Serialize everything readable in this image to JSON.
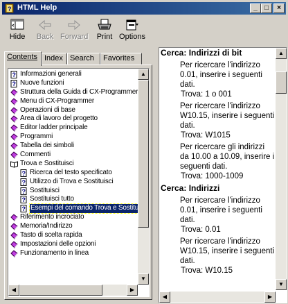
{
  "window": {
    "title": "HTML Help",
    "buttons": {
      "minimize": "_",
      "maximize": "□",
      "close": "×"
    }
  },
  "toolbar": {
    "items": [
      {
        "label": "Hide",
        "icon": "hide-icon",
        "enabled": true
      },
      {
        "label": "Back",
        "icon": "back-arrow-icon",
        "enabled": false
      },
      {
        "label": "Forward",
        "icon": "forward-arrow-icon",
        "enabled": false
      },
      {
        "label": "Print",
        "icon": "printer-icon",
        "enabled": true
      },
      {
        "label": "Options",
        "icon": "options-icon",
        "enabled": true
      }
    ]
  },
  "tabs": [
    {
      "label": "Contents",
      "active": true
    },
    {
      "label": "Index",
      "active": false
    },
    {
      "label": "Search",
      "active": false
    },
    {
      "label": "Favorites",
      "active": false
    }
  ],
  "tree": [
    {
      "label": "Informazioni generali",
      "icon": "page-question-icon",
      "indent": 0
    },
    {
      "label": "Nuove funzioni",
      "icon": "page-question-icon",
      "indent": 0
    },
    {
      "label": "Struttura della Guida di CX-Programmer",
      "icon": "book-closed-icon",
      "indent": 0
    },
    {
      "label": "Menu di CX-Programmer",
      "icon": "book-closed-icon",
      "indent": 0
    },
    {
      "label": "Operazioni di base",
      "icon": "book-closed-icon",
      "indent": 0
    },
    {
      "label": "Area di lavoro del progetto",
      "icon": "book-closed-icon",
      "indent": 0
    },
    {
      "label": "Editor ladder principale",
      "icon": "book-closed-icon",
      "indent": 0
    },
    {
      "label": "Programmi",
      "icon": "book-closed-icon",
      "indent": 0
    },
    {
      "label": "Tabella dei simboli",
      "icon": "book-closed-icon",
      "indent": 0
    },
    {
      "label": "Commenti",
      "icon": "book-closed-icon",
      "indent": 0
    },
    {
      "label": "Trova e Sostituisci",
      "icon": "book-open-icon",
      "indent": 0
    },
    {
      "label": "Ricerca del testo specificato",
      "icon": "page-question-icon",
      "indent": 1
    },
    {
      "label": "Utilizzo di Trova e Sostituisci",
      "icon": "page-question-icon",
      "indent": 1
    },
    {
      "label": "Sostituisci",
      "icon": "page-question-icon",
      "indent": 1
    },
    {
      "label": "Sostituisci tutto",
      "icon": "page-question-icon",
      "indent": 1
    },
    {
      "label": "Esempi del comando Trova e Sostituisci",
      "icon": "page-question-icon",
      "indent": 1,
      "selected": true
    },
    {
      "label": "Riferimento incrociato",
      "icon": "book-closed-icon",
      "indent": 0
    },
    {
      "label": "Memoria/Indirizzo",
      "icon": "book-closed-icon",
      "indent": 0
    },
    {
      "label": "Tasto di scelta rapida",
      "icon": "book-closed-icon",
      "indent": 0
    },
    {
      "label": "Impostazioni delle opzioni",
      "icon": "book-closed-icon",
      "indent": 0
    },
    {
      "label": "Funzionamento in linea",
      "icon": "book-closed-icon",
      "indent": 0
    }
  ],
  "content": {
    "heading1": "Cerca: Indirizzi di bit",
    "p1": "Per ricercare l'indirizzo 0.01, inserire i seguenti dati.",
    "p1_trova": "Trova: 1 o 001",
    "p2": "Per ricercare l'indirizzo W10.15, inserire i seguenti dati.",
    "p2_trova": "Trova: W1015",
    "p3": "Per ricercare gli indirizzi da 10.00 a 10.09, inserire i seguenti dati.",
    "p3_trova": "Trova: 1000-1009",
    "heading2": "Cerca: Indirizzi",
    "p4": "Per ricercare l'indirizzo 0.01, inserire i seguenti dati.",
    "p4_trova": "Trova: 0.01",
    "p5": "Per ricercare l'indirizzo W10.15, inserire i seguenti dati.",
    "p5_trova": "Trova: W10.15"
  },
  "side_arrow": "→"
}
